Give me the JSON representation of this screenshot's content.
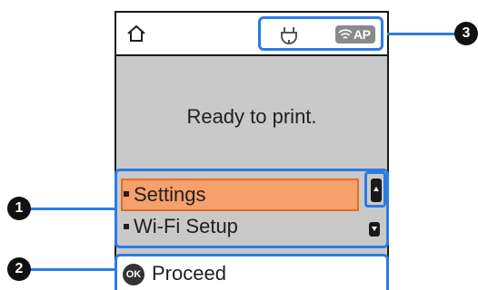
{
  "status_bar": {
    "home_icon": "home-icon",
    "power_icon": "power-icon",
    "ap_badge": "AP"
  },
  "main": {
    "status_text": "Ready to print."
  },
  "menu": {
    "items": [
      {
        "label": "Settings",
        "selected": true
      },
      {
        "label": "Wi-Fi Setup",
        "selected": false
      }
    ]
  },
  "footer": {
    "ok_icon": "OK",
    "label": "Proceed"
  },
  "callouts": {
    "menu_number": "1",
    "footer_number": "2",
    "status_number": "3"
  },
  "colors": {
    "highlight_blue": "#2c7be5",
    "selected_fill": "#f6a06b",
    "selected_border": "#e46d25",
    "screen_background": "#c9c9c9"
  }
}
